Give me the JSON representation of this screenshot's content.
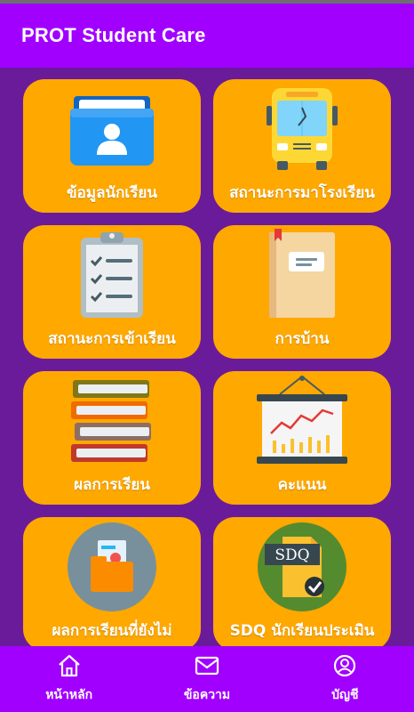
{
  "app": {
    "title": "PROT Student Care"
  },
  "tiles": [
    {
      "label": "ข้อมูลนักเรียน",
      "icon": "student-folder-icon"
    },
    {
      "label": "สถานะการมาโรงเรียน",
      "icon": "school-bus-icon"
    },
    {
      "label": "สถานะการเข้าเรียน",
      "icon": "checklist-clipboard-icon"
    },
    {
      "label": "การบ้าน",
      "icon": "notebook-icon"
    },
    {
      "label": "ผลการเรียน",
      "icon": "book-stack-icon"
    },
    {
      "label": "คะแนน",
      "icon": "line-chart-board-icon"
    },
    {
      "label": "ผลการเรียนที่ยังไม่",
      "icon": "report-folder-icon"
    },
    {
      "label": "SDQ นักเรียนประเมิน",
      "icon": "sdq-document-icon",
      "icon_text": "SDQ"
    }
  ],
  "bottom_nav": [
    {
      "label": "หน้าหลัก",
      "icon": "home-icon"
    },
    {
      "label": "ข้อความ",
      "icon": "mail-icon"
    },
    {
      "label": "บัญชี",
      "icon": "account-icon"
    }
  ],
  "colors": {
    "app_bar": "#a100ff",
    "background": "#6a1b9a",
    "tile": "#ffa800"
  }
}
